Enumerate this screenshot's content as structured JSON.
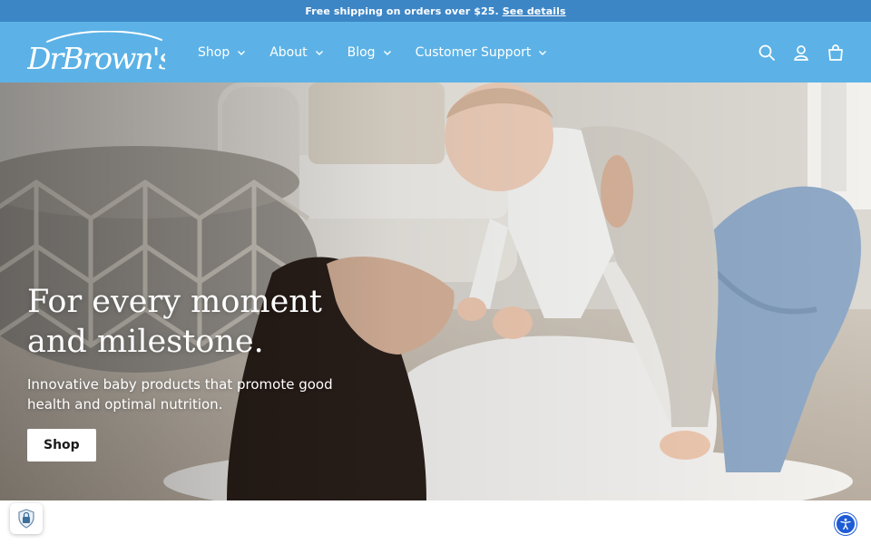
{
  "announcement": {
    "text": "Free shipping on orders over $25.",
    "link_label": "See details"
  },
  "header": {
    "logo_text": "DrBrown's",
    "nav": [
      {
        "label": "Shop"
      },
      {
        "label": "About"
      },
      {
        "label": "Blog"
      },
      {
        "label": "Customer Support"
      }
    ],
    "icons": [
      "search-icon",
      "account-icon",
      "cart-icon"
    ]
  },
  "hero": {
    "title_line1": "For every moment",
    "title_line2": "and milestone.",
    "subtitle_line1": "Innovative baby products that promote good",
    "subtitle_line2": "health and optimal nutrition.",
    "button_label": "Shop"
  },
  "widgets": {
    "left_badge_icon": "shield-lock-icon",
    "accessibility_icon": "accessibility-icon"
  },
  "colors": {
    "announcement_bg": "#3d86c6",
    "header_bg": "#5cb2e6",
    "accessibility_bg": "#1e5bd6"
  }
}
